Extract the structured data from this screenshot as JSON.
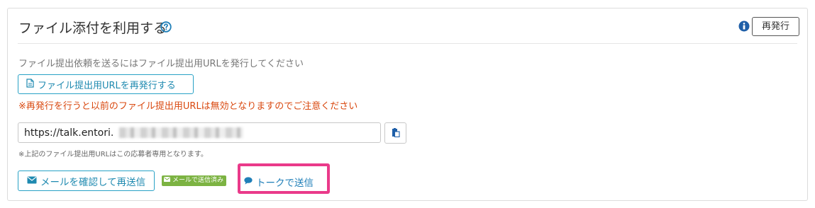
{
  "panel": {
    "title": "ファイル添付を利用する",
    "header_button": "再発行"
  },
  "instruction": "ファイル提出依頼を送るにはファイル提出用URLを発行してください",
  "reissue_url_button": "ファイル提出用URLを再発行する",
  "warning": "※再発行を行うと以前のファイル提出用URLは無効となりますのでご注意ください",
  "url_field": {
    "value": "https://talk.entori."
  },
  "note": "※上記のファイル提出用URLはこの応募者専用となります。",
  "actions": {
    "resend_mail": "メールを確認して再送信",
    "sent_badge": "メールで送信済み",
    "send_talk": "トークで送信"
  },
  "icons": {
    "help": "question-circle-icon",
    "info": "info-circle-icon",
    "document": "document-icon",
    "copy": "copy-icon",
    "envelope": "envelope-icon",
    "chat": "chat-bubble-icon"
  },
  "colors": {
    "accent": "#29a2c6",
    "warning": "#d9480f",
    "badge": "#7cb342",
    "highlight": "#ea3a8a"
  }
}
